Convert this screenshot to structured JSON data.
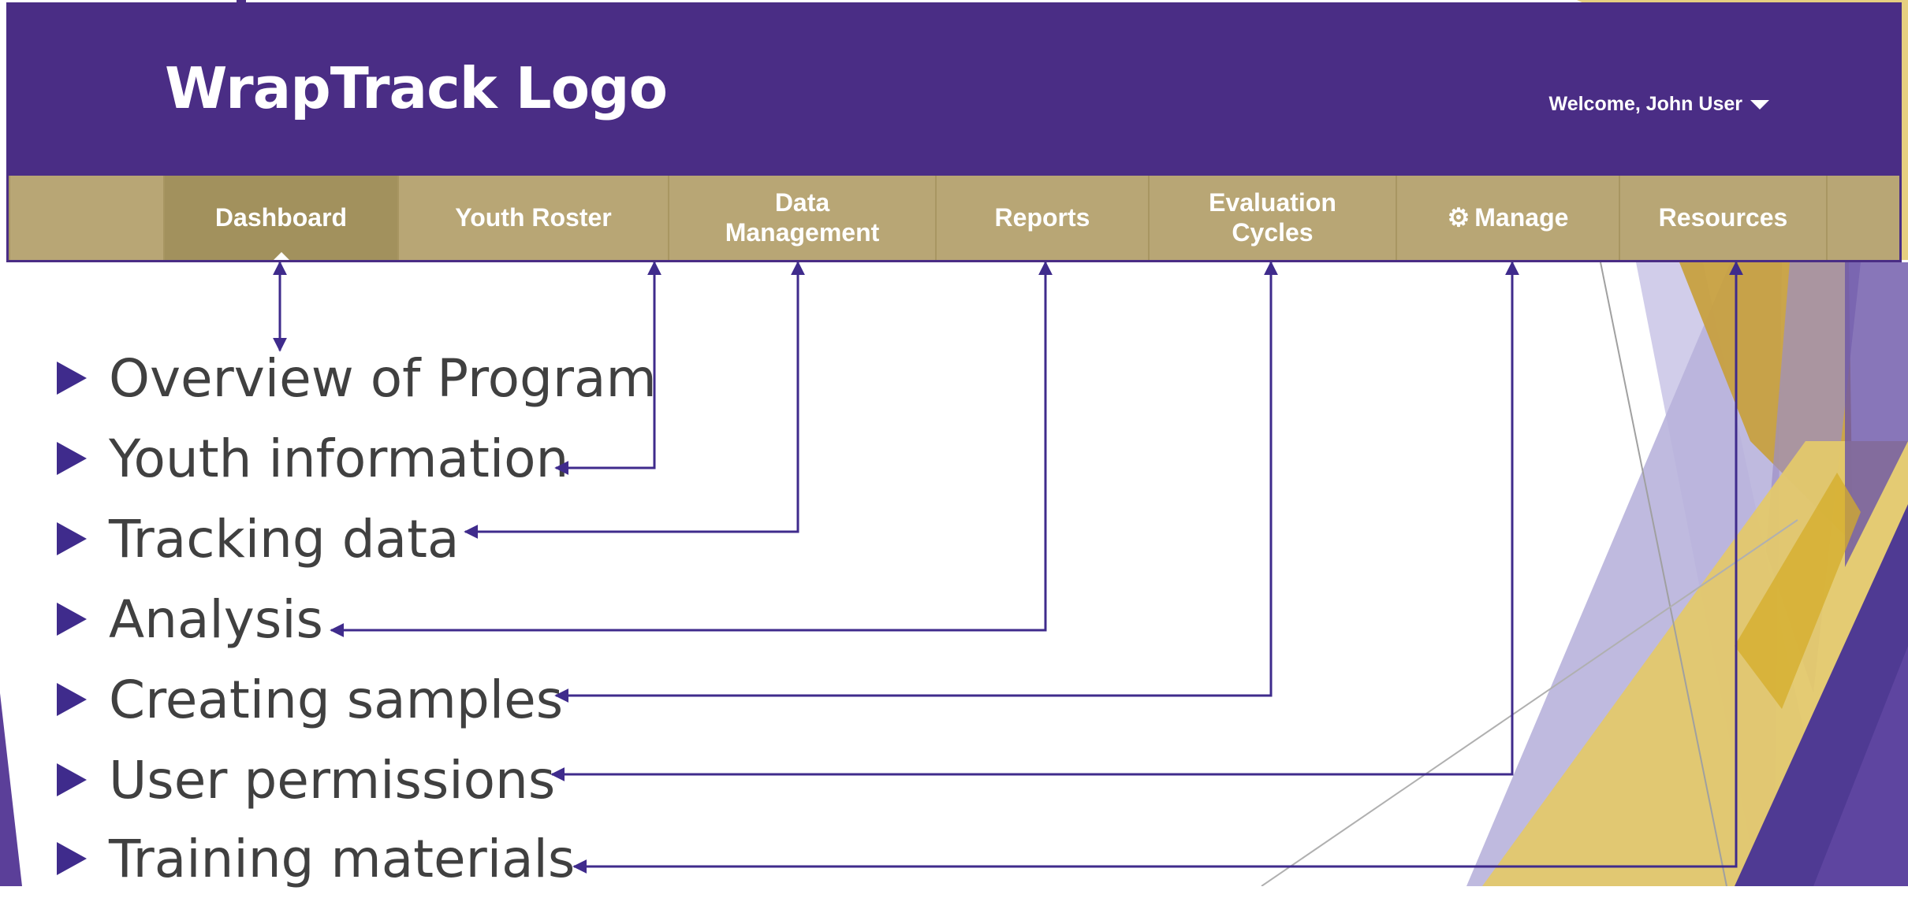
{
  "app": {
    "logo_text": "WrapTrack Logo",
    "welcome": "Welcome, John User",
    "brand_color": "#4a2d85",
    "nav_color": "#b8a675"
  },
  "nav": [
    {
      "id": "dashboard",
      "label": "Dashboard",
      "active": true
    },
    {
      "id": "youth-roster",
      "label": "Youth Roster"
    },
    {
      "id": "data-management",
      "label": "Data Management"
    },
    {
      "id": "reports",
      "label": "Reports"
    },
    {
      "id": "evaluation-cycles",
      "label": "Evaluation Cycles"
    },
    {
      "id": "manage",
      "label": "Manage",
      "icon": "gear-icon"
    },
    {
      "id": "resources",
      "label": "Resources"
    }
  ],
  "features": [
    "Overview of Program",
    "Youth information",
    "Tracking data",
    "Analysis",
    "Creating samples",
    "User permissions",
    "Training materials"
  ],
  "colors": {
    "bullet": "#3f2b8c",
    "arrow": "#3f2b8c",
    "decor_purple": "#5b3f99",
    "decor_gold": "#d9a82e"
  }
}
